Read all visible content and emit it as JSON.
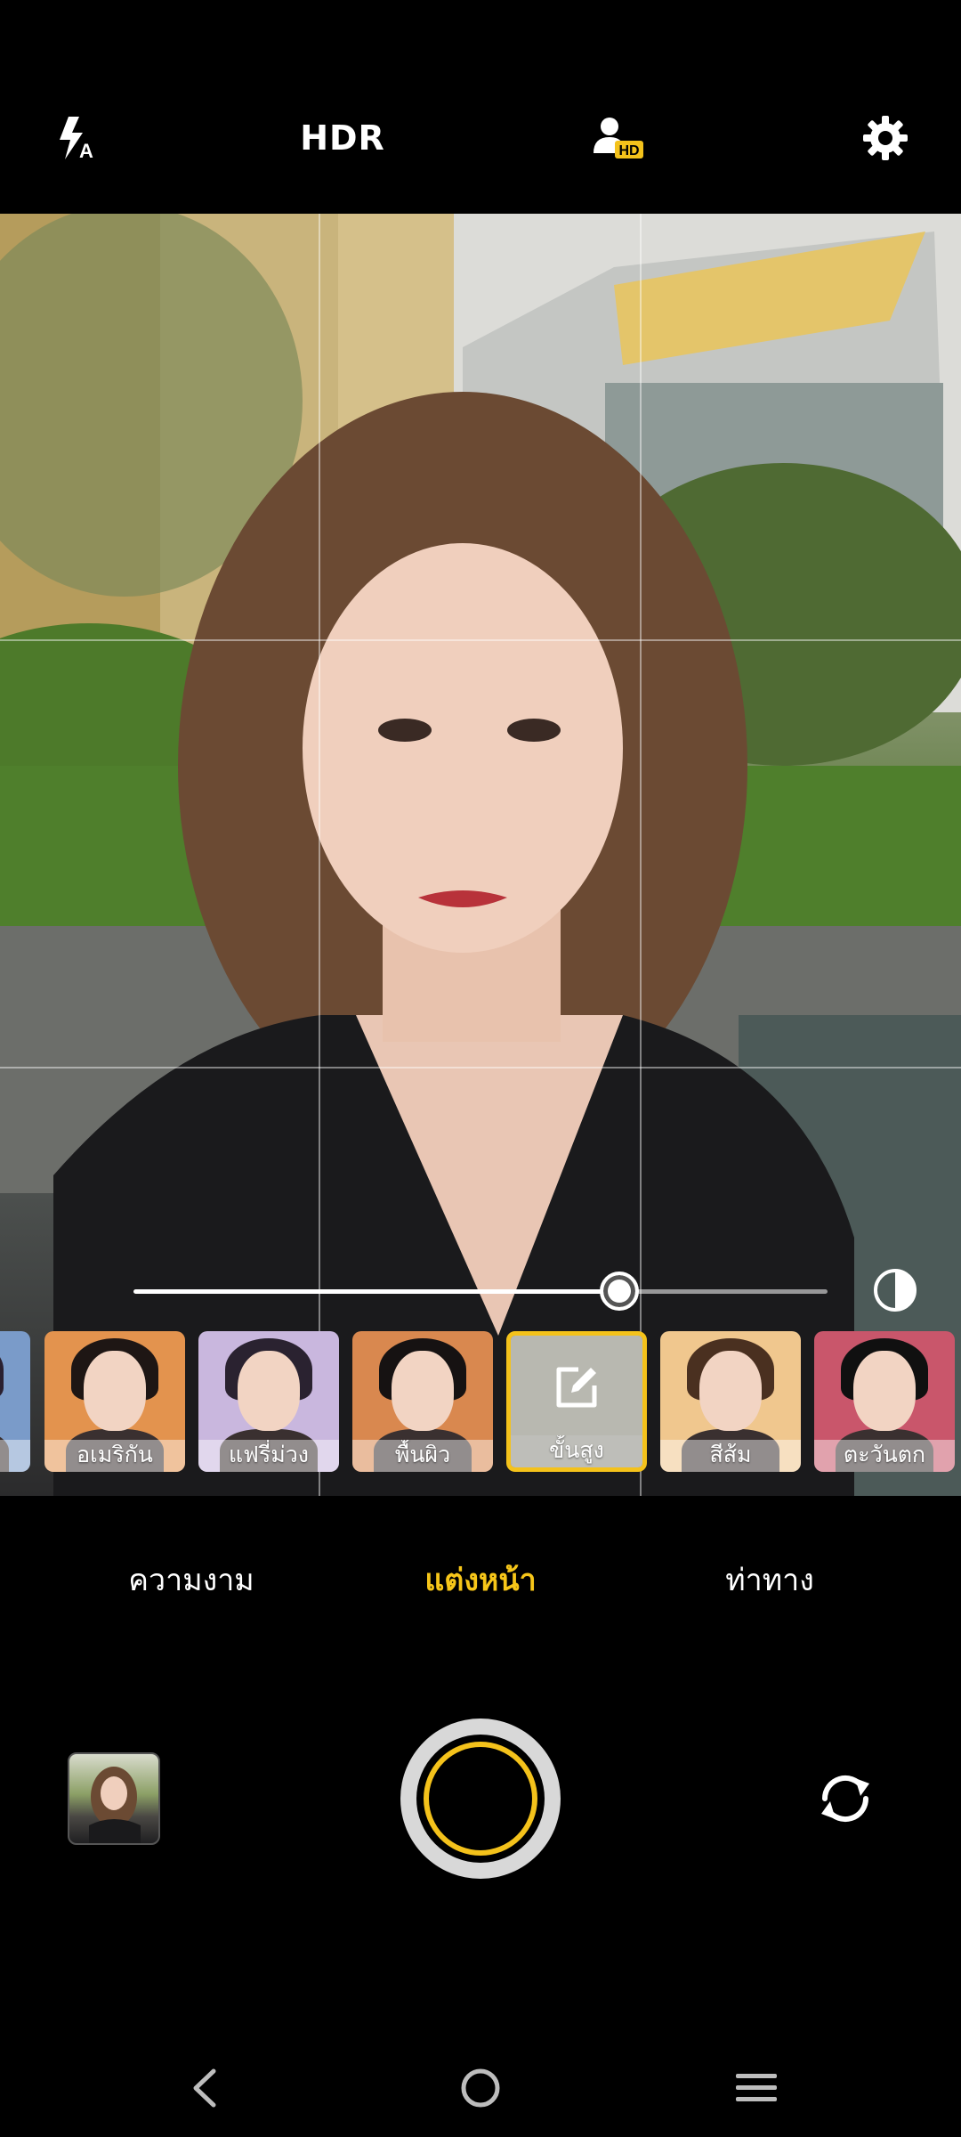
{
  "topbar": {
    "hdr_label": "HDR"
  },
  "beauty_slider": {
    "level": 0.7
  },
  "filters": [
    {
      "label": "ห..",
      "bg": "#7a9bc9"
    },
    {
      "label": "อเมริกัน",
      "bg": "#e3934e"
    },
    {
      "label": "แฟรี่ม่วง",
      "bg": "#c9b7de"
    },
    {
      "label": "พื้นผิว",
      "bg": "#d9884f"
    },
    {
      "label": "ขั้นสูง",
      "bg": "#b8b8b0",
      "selected": true
    },
    {
      "label": "สีส้ม",
      "bg": "#f0c78e"
    },
    {
      "label": "ตะวันตก",
      "bg": "#c9566b"
    }
  ],
  "modes": [
    {
      "label": "ความงาม"
    },
    {
      "label": "แต่งหน้า",
      "active": true
    },
    {
      "label": "ท่าทาง"
    }
  ],
  "colors": {
    "accent": "#f4c21b",
    "background": "#000000"
  }
}
